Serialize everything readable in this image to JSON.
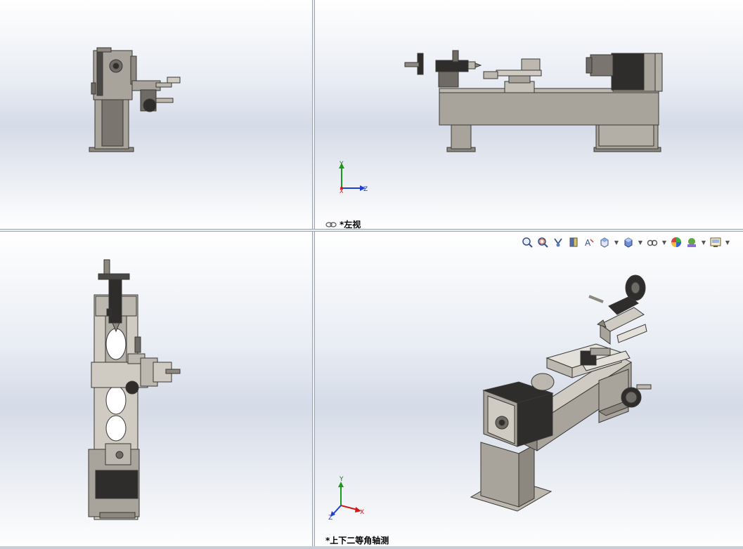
{
  "viewports": {
    "top_left": {
      "label": ""
    },
    "top_right": {
      "label": "*左视",
      "triad": {
        "y": "Y",
        "z": "Z",
        "x": "X"
      }
    },
    "bottom_left": {
      "label": ""
    },
    "bottom_right": {
      "label": "*上下二等角轴测",
      "triad": {
        "y": "Y",
        "x": "X",
        "z": "Z"
      }
    }
  },
  "heads_up_toolbar": {
    "icons": [
      "zoom-to-fit-icon",
      "zoom-to-area-icon",
      "previous-view-icon",
      "section-view-icon",
      "dynamic-annotation-icon",
      "view-orientation-icon",
      "display-style-icon",
      "hide-show-items-icon",
      "edit-appearance-icon",
      "apply-scene-icon",
      "view-settings-icon"
    ]
  },
  "colors": {
    "model_body": "#a8a39b",
    "model_dark": "#2e2d2c",
    "model_edge": "#3a3835",
    "axis_y": "#1a9a1a",
    "axis_z": "#1e3fcf",
    "axis_x": "#d01818",
    "splitter": "#9aa2b0"
  }
}
